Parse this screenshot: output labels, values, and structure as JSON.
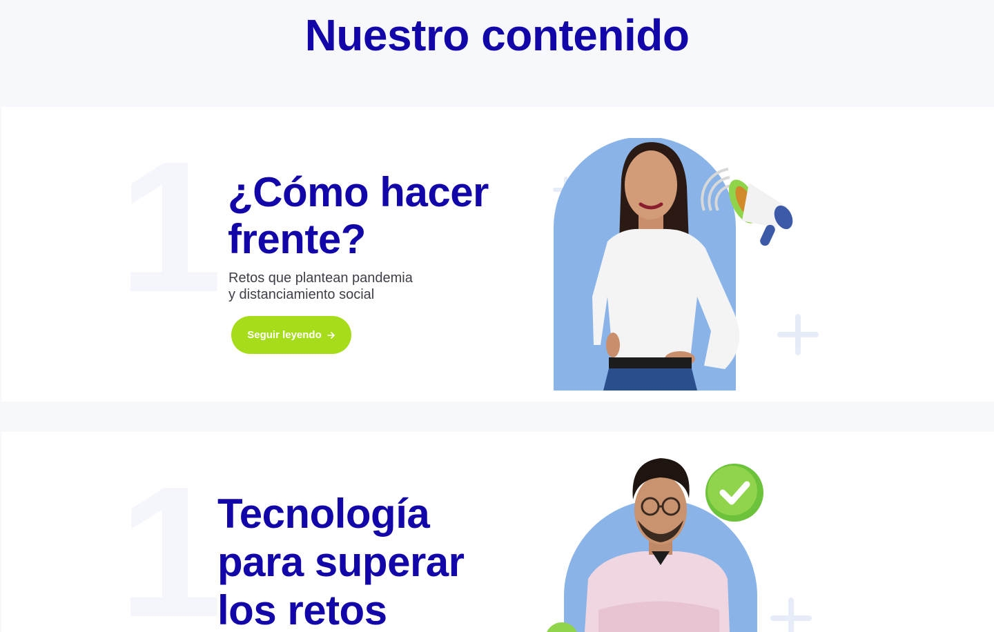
{
  "section_title": "Nuestro contenido",
  "articles": [
    {
      "number": "1",
      "title_line1": "¿Cómo hacer",
      "title_line2": "frente?",
      "subtitle_line1": "Retos que plantean pandemia",
      "subtitle_line2": "y distanciamiento social",
      "cta_label": "Seguir leyendo",
      "cta_icon": "arrow-right-icon",
      "image_icons": [
        "megaphone-icon",
        "plus-icon"
      ]
    },
    {
      "number": "1",
      "title_line1": "Tecnología",
      "title_line2": "para superar",
      "title_line3": "los retos",
      "image_icons": [
        "checkmark-icon",
        "plus-icon"
      ]
    }
  ],
  "colors": {
    "brand_blue": "#1306a8",
    "accent_green": "#a6dc1a",
    "photo_backdrop": "#8ab4e8",
    "page_background": "#f6f8fc",
    "card_background": "#ffffff"
  }
}
